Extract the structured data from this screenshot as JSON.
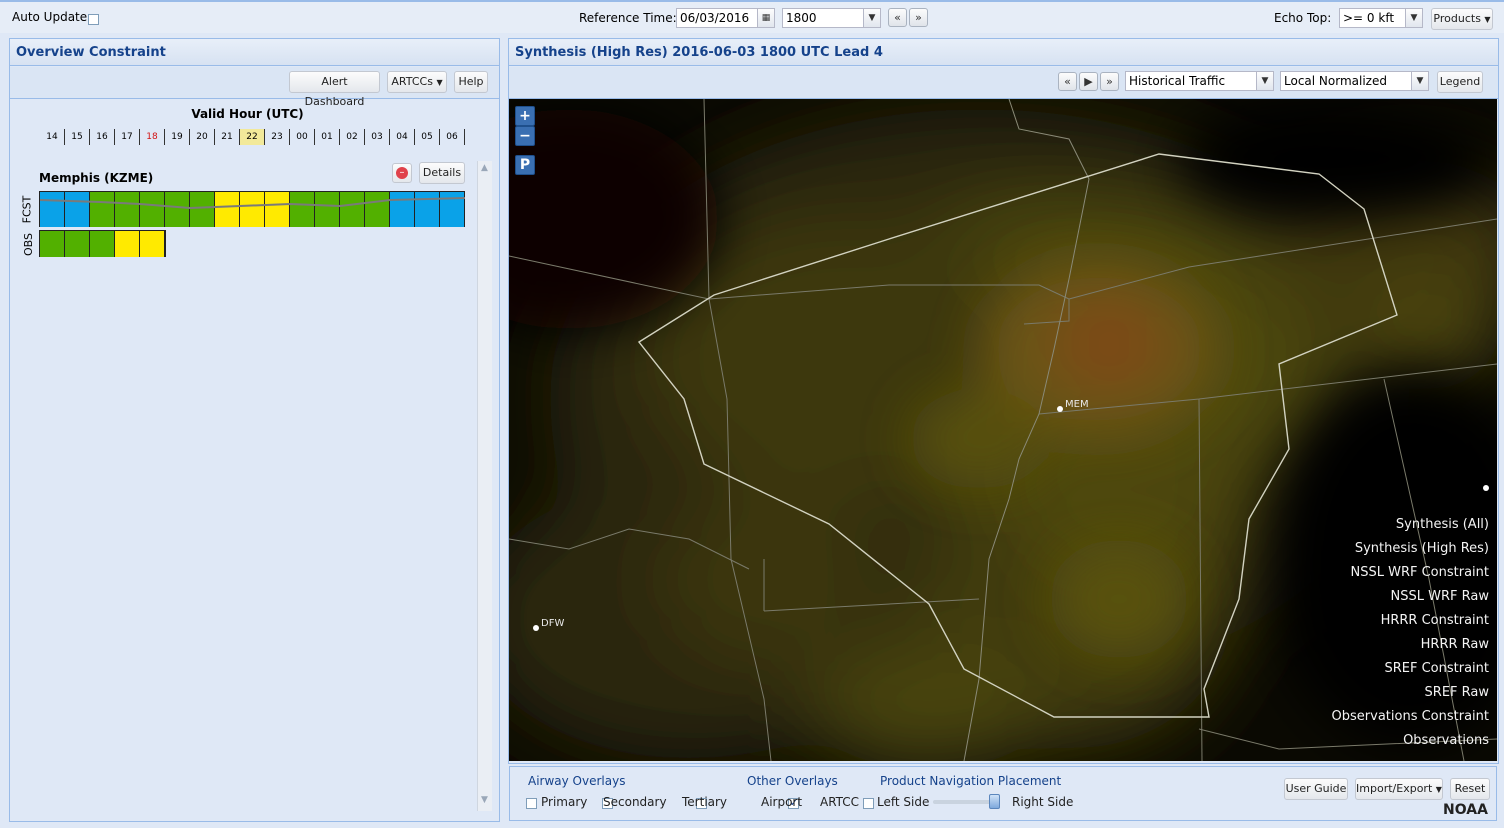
{
  "topbar": {
    "auto_update_label": "Auto Update",
    "reference_time_label": "Reference Time:",
    "date_value": "06/03/2016",
    "time_value": "1800",
    "echo_top_label": "Echo Top:",
    "echo_top_value": ">= 0 kft",
    "products_label": "Products"
  },
  "left_panel": {
    "title": "Overview Constraint",
    "alert_dashboard_label": "Alert Dashboard",
    "artccs_label": "ARTCCs",
    "help_label": "Help",
    "valid_hour_label": "Valid Hour (UTC)",
    "hours": [
      "14",
      "15",
      "16",
      "17",
      "18",
      "19",
      "20",
      "21",
      "22",
      "23",
      "00",
      "01",
      "02",
      "03",
      "04",
      "05",
      "06"
    ],
    "current_hour": "18",
    "highlight_hour": "22",
    "center": {
      "name": "Memphis (KZME)",
      "details_label": "Details",
      "fcst_label": "FCST",
      "obs_label": "OBS",
      "fcst_colors": [
        "#0aa2e8",
        "#0aa2e8",
        "#52b000",
        "#52b000",
        "#52b000",
        "#52b000",
        "#52b000",
        "#ffea00",
        "#ffea00",
        "#ffea00",
        "#52b000",
        "#52b000",
        "#52b000",
        "#52b000",
        "#0aa2e8",
        "#0aa2e8",
        "#0aa2e8"
      ],
      "obs_colors": [
        "#52b000",
        "#52b000",
        "#52b000",
        "#ffea00",
        "#ffea00"
      ]
    }
  },
  "right_panel": {
    "title": "Synthesis (High Res) 2016-06-03 1800 UTC Lead 4",
    "traffic_select": "Historical Traffic",
    "normalization_select": "Local Normalized",
    "legend_label": "Legend",
    "map": {
      "zoom_in": "+",
      "zoom_out": "−",
      "p_button": "P",
      "airports": {
        "mem": "MEM",
        "dfw": "DFW"
      },
      "products": [
        "Synthesis (All)",
        "Synthesis (High Res)",
        "NSSL WRF Constraint",
        "NSSL WRF Raw",
        "HRRR Constraint",
        "HRRR Raw",
        "SREF Constraint",
        "SREF Raw",
        "Observations Constraint",
        "Observations"
      ]
    }
  },
  "bottom": {
    "airway_overlays_label": "Airway Overlays",
    "primary_label": "Primary",
    "secondary_label": "Secondary",
    "tertiary_label": "Tertiary",
    "other_overlays_label": "Other Overlays",
    "airport_label": "Airport",
    "artcc_label": "ARTCC",
    "airport_checked": true,
    "product_nav_label": "Product Navigation Placement",
    "left_side_label": "Left Side",
    "right_side_label": "Right Side",
    "user_guide_label": "User Guide",
    "import_export_label": "Import/Export",
    "reset_label": "Reset",
    "noaa_label": "NOAA"
  }
}
